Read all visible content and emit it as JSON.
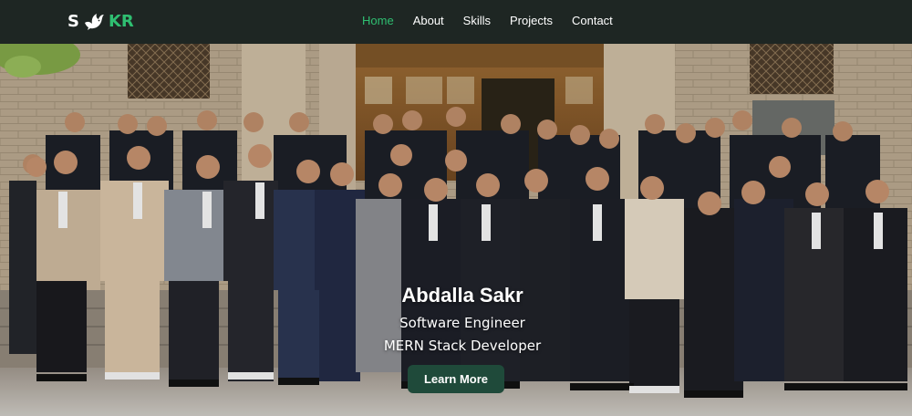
{
  "brand": {
    "left": "S",
    "right": "KR",
    "accent": "#2fbf71"
  },
  "nav": {
    "items": [
      {
        "label": "Home",
        "active": true
      },
      {
        "label": "About",
        "active": false
      },
      {
        "label": "Skills",
        "active": false
      },
      {
        "label": "Projects",
        "active": false
      },
      {
        "label": "Contact",
        "active": false
      }
    ]
  },
  "hero": {
    "name": "Abdalla Sakr",
    "role_1": "Software Engineer",
    "role_2": "MERN Stack Developer",
    "cta_label": "Learn More"
  },
  "colors": {
    "nav_bg": "#1e2623",
    "button_bg": "#1f4a3a"
  }
}
